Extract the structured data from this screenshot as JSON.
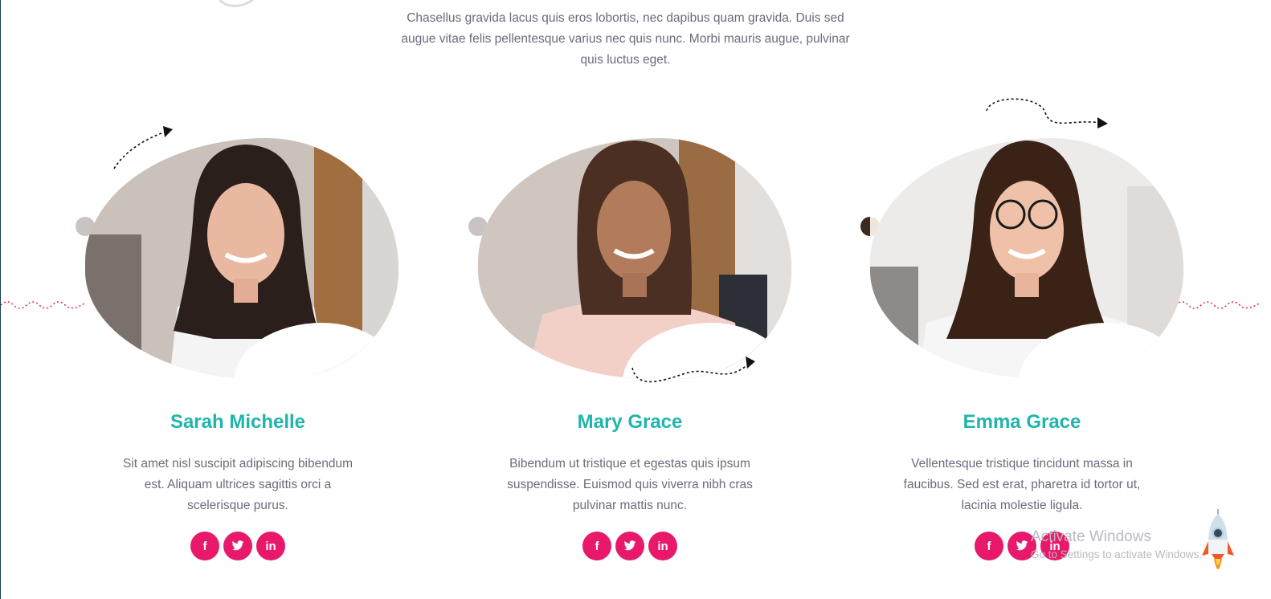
{
  "intro": {
    "text": "Chasellus gravida lacus quis eros lobortis, nec dapibus quam gravida. Duis sed augue vitae felis pellentesque varius nec quis nunc. Morbi mauris augue, pulvinar quis luctus eget."
  },
  "team": [
    {
      "name": "Sarah Michelle",
      "bio": "Sit amet nisl suscipit adipiscing bibendum est. Aliquam ultrices sagittis orci a scelerisque purus.",
      "socials": [
        "f",
        "twitter",
        "in"
      ]
    },
    {
      "name": "Mary Grace",
      "bio": "Bibendum ut tristique et egestas quis ipsum suspendisse. Euismod quis viverra nibh cras pulvinar mattis nunc.",
      "socials": [
        "f",
        "twitter",
        "in"
      ]
    },
    {
      "name": "Emma Grace",
      "bio": "Vellentesque tristique tincidunt massa in faucibus. Sed est erat, pharetra id tortor ut, lacinia molestie ligula.",
      "socials": [
        "f",
        "twitter",
        "in"
      ]
    }
  ],
  "social_icons": {
    "facebook": "f",
    "twitter": "🐦",
    "linkedin": "in"
  },
  "watermark": {
    "title": "Activate Windows",
    "subtitle": "Go to Settings to activate Windows."
  },
  "colors": {
    "name": "#1fb5ac",
    "social_bg": "#e8196b",
    "body_text": "#6b6b7e",
    "wave": "#e8196b"
  }
}
